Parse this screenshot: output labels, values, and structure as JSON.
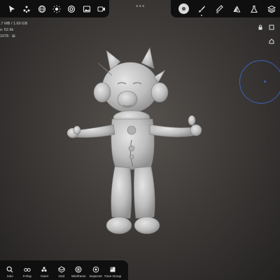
{
  "top_left_tools": [
    {
      "name": "select-icon"
    },
    {
      "name": "topology-icon"
    },
    {
      "name": "sphere-grid-icon"
    },
    {
      "name": "light-icon"
    },
    {
      "name": "target-icon"
    },
    {
      "name": "image-icon"
    },
    {
      "name": "video-icon"
    }
  ],
  "top_right_tools": [
    {
      "name": "sculpt-brush-icon",
      "active": true
    },
    {
      "name": "brush-icon"
    },
    {
      "name": "paint-icon"
    },
    {
      "name": "symmetry-icon"
    },
    {
      "name": "flask-icon"
    },
    {
      "name": "layers-icon"
    }
  ],
  "stats": {
    "memory": ".7 MB / 1.69 GB",
    "vertices": "s: 52.6k",
    "faces": "1078 · ⊞"
  },
  "bottom_tools": [
    {
      "label": "Solo"
    },
    {
      "label": "X-Ray"
    },
    {
      "label": "Voxel"
    },
    {
      "label": "Grid"
    },
    {
      "label": "Wireframe"
    },
    {
      "label": "Inspector"
    },
    {
      "label": "Face Group"
    }
  ],
  "colors": {
    "accent": "#3d62b8",
    "toolbar_bg": "#0f0f10",
    "model": "#c9c9c9"
  }
}
